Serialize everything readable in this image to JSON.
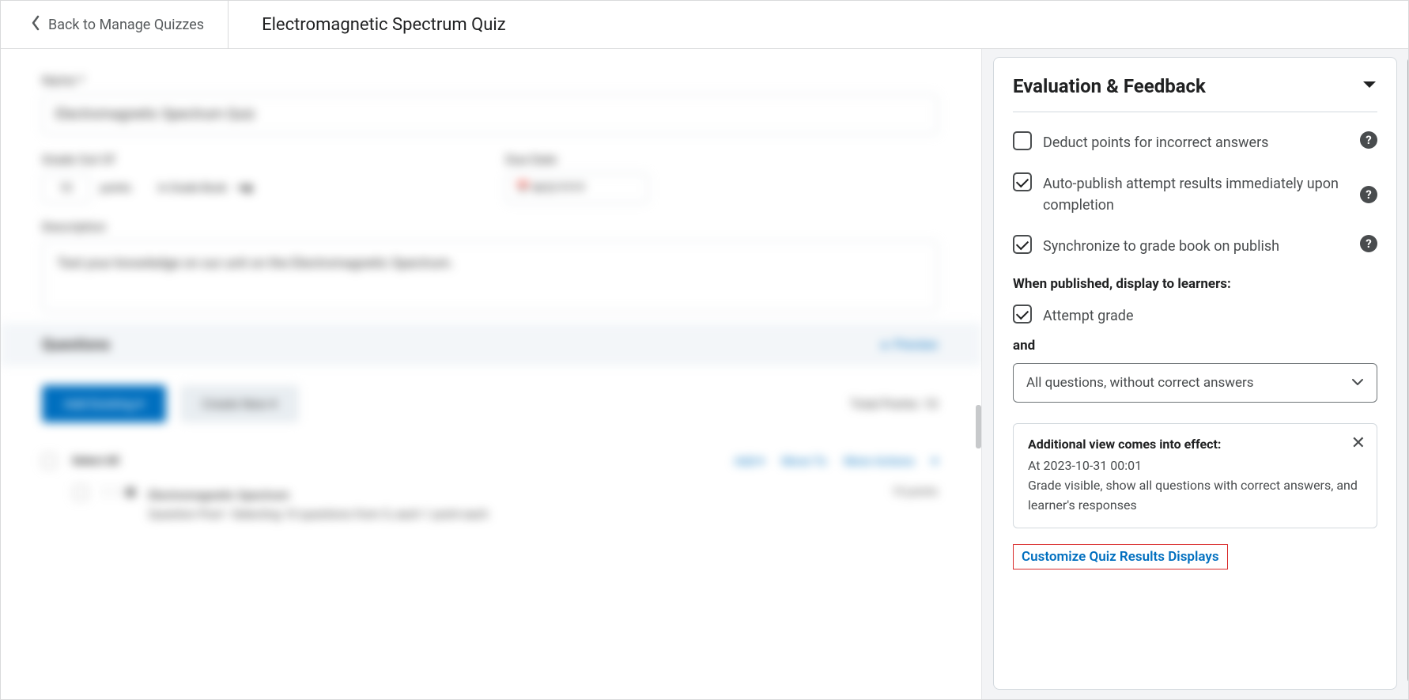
{
  "header": {
    "back_label": "Back to Manage Quizzes",
    "title": "Electromagnetic Spectrum Quiz"
  },
  "main_blurred": {
    "name_label": "Name *",
    "name_value": "Electromagnetic Spectrum Quiz",
    "grade_label": "Grade Out Of",
    "grade_value": "10",
    "points_text": "points",
    "in_gradebook": "In Grade Book",
    "due_label": "Due Date",
    "due_placeholder": "M/D/YYYY",
    "desc_label": "Description",
    "desc_value": "Test your knowledge on our unit on the Electromagnetic Spectrum.",
    "questions_heading": "Questions",
    "preview": "Preview",
    "add_existing": "Add Existing",
    "create_new": "Create New",
    "total_points": "Total Points: 10",
    "select_all": "Select All",
    "move_to": "Move To",
    "more_actions": "More Actions",
    "q_title": "Electromagnetic Spectrum",
    "q_sub": "Question Pool • Selecting 10 questions from 5, each 1 point each",
    "q_pts": "10 points"
  },
  "panel": {
    "title": "Evaluation & Feedback",
    "options": {
      "deduct": {
        "label": "Deduct points for incorrect answers",
        "checked": false,
        "help": true
      },
      "autoPublish": {
        "label": "Auto-publish attempt results immediately upon completion",
        "checked": true,
        "help": true
      },
      "syncGrade": {
        "label": "Synchronize to grade book on publish",
        "checked": true,
        "help": true
      }
    },
    "display_heading": "When published, display to learners:",
    "attempt_grade": {
      "label": "Attempt grade",
      "checked": true
    },
    "and_text": "and",
    "select_value": "All questions, without correct answers",
    "notice": {
      "title": "Additional view comes into effect:",
      "time": "At 2023-10-31 00:01",
      "desc": "Grade visible, show all questions with correct answers, and learner's responses"
    },
    "customize_label": "Customize Quiz Results Displays"
  }
}
